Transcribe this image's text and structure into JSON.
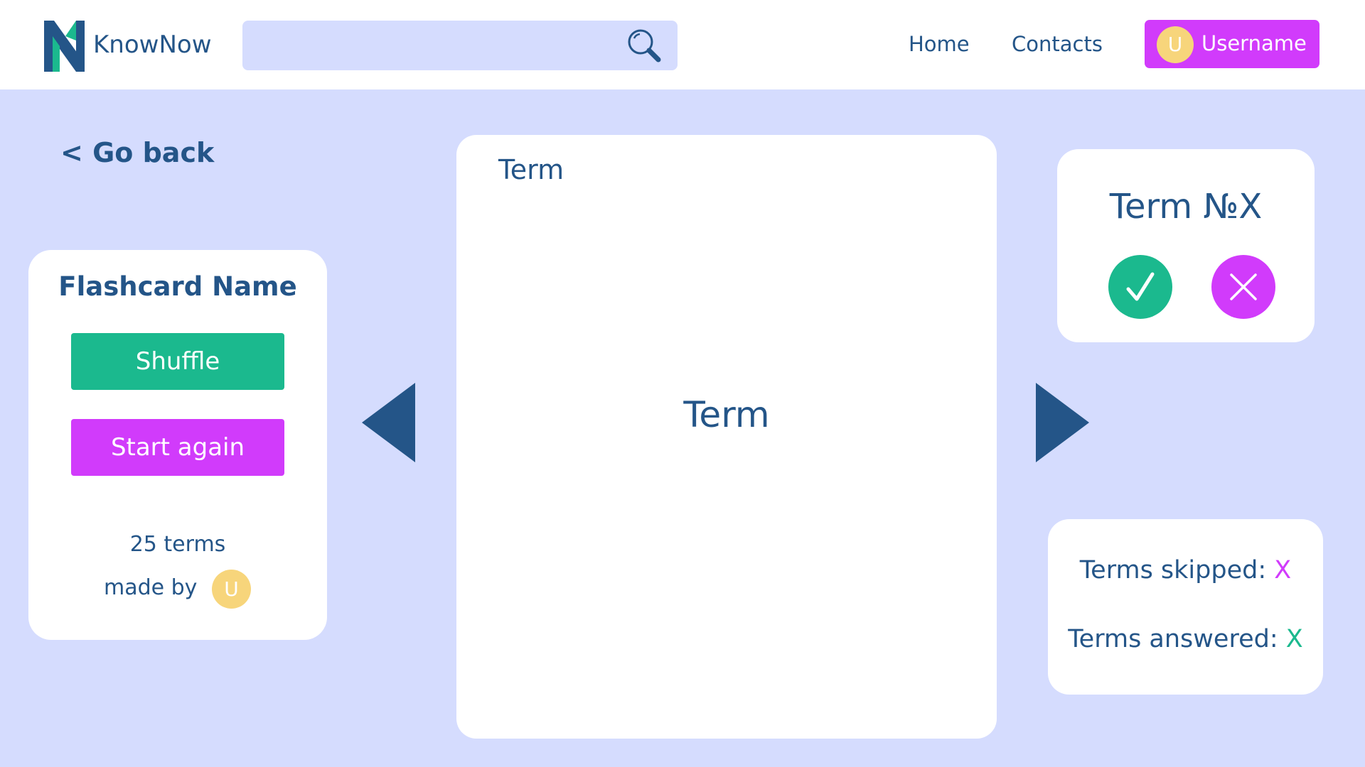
{
  "colors": {
    "background": "#D5DCFE",
    "primary_text": "#245588",
    "accent_green": "#1BB98E",
    "accent_purple": "#D13BFB",
    "avatar_yellow": "#F7D57B"
  },
  "header": {
    "brand": "KnowNow",
    "search": {
      "value": "",
      "icon": "search-icon"
    },
    "nav": {
      "home": "Home",
      "contacts": "Contacts"
    },
    "user": {
      "avatar_initial": "U",
      "name": "Username"
    }
  },
  "go_back_label": "< Go back",
  "flashcard_panel": {
    "title": "Flashcard Name",
    "shuffle_label": "Shuffle",
    "start_again_label": "Start again",
    "terms_count": "25 terms",
    "made_by_label": "made by",
    "author_initial": "U"
  },
  "card": {
    "corner_label": "Term",
    "main_text": "Term"
  },
  "navigation": {
    "prev_icon": "triangle-left-icon",
    "next_icon": "triangle-right-icon"
  },
  "term_panel": {
    "term_number": "Term №X",
    "correct_icon": "checkmark-icon",
    "wrong_icon": "close-icon"
  },
  "stats": {
    "skipped_label": "Terms skipped:",
    "skipped_value": "X",
    "answered_label": "Terms answered:",
    "answered_value": "X"
  }
}
